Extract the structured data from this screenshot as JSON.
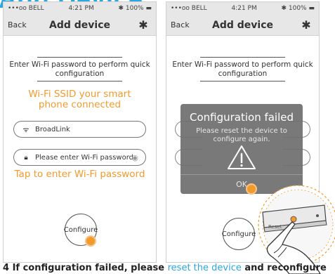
{
  "heading": "Add Device",
  "status_bar": {
    "carrier": "•••oo BELL",
    "time": "4:21 PM",
    "battery": "100%"
  },
  "nav": {
    "back": "Back",
    "title": "Add device",
    "settings_icon": "gear-icon"
  },
  "left_screen": {
    "instruction": "Enter Wi-Fi password to perform quick configuration",
    "annotation_ssid": "Wi-Fi SSID your smart phone connected",
    "ssid_value": "BroadLink",
    "password_placeholder": "Please enter Wi-Fi password",
    "annotation_password": "Tap to enter Wi-Fi password",
    "configure_label": "Configure"
  },
  "right_screen": {
    "instruction": "Enter Wi-Fi password to perform quick configuration",
    "dialog_title": "Configuration failed",
    "dialog_message": "Please reset the device to configure again.",
    "dialog_ok": "OK",
    "configure_label": "Configure",
    "reset_label": "Reset"
  },
  "bottom": {
    "part1": "4 If configuration failed, please ",
    "part2": "reset the device",
    "part3": " and reconfigure"
  },
  "colors": {
    "accent_orange": "#f39a2c",
    "brand_blue": "#2aa7e0"
  }
}
